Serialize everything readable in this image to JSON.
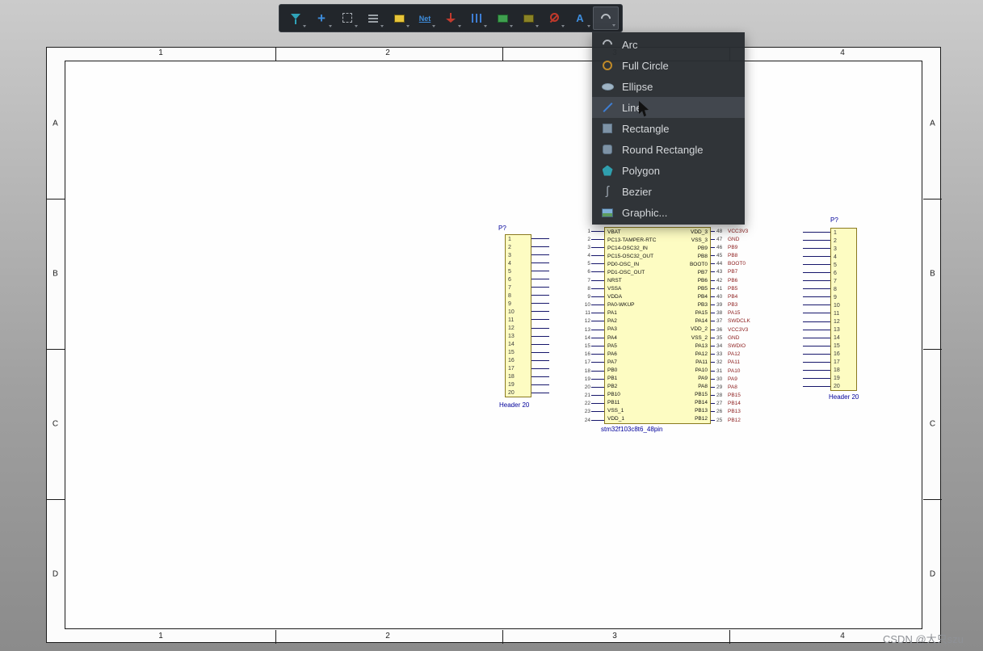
{
  "toolbar": {
    "tools": [
      {
        "id": "filter",
        "glyph": "",
        "active": ""
      },
      {
        "id": "crosshair",
        "glyph": "+",
        "active": ""
      },
      {
        "id": "selection",
        "glyph": "",
        "active": ""
      },
      {
        "id": "align",
        "glyph": "",
        "active": ""
      },
      {
        "id": "place-part",
        "glyph": "",
        "active": ""
      },
      {
        "id": "net-label",
        "glyph": "Net",
        "active": ""
      },
      {
        "id": "power-port",
        "glyph": "",
        "active": ""
      },
      {
        "id": "bus",
        "glyph": "",
        "active": ""
      },
      {
        "id": "sheet-symbol",
        "glyph": "",
        "active": ""
      },
      {
        "id": "sheet-entry",
        "glyph": "",
        "active": ""
      },
      {
        "id": "no-erc",
        "glyph": "",
        "active": ""
      },
      {
        "id": "text-string",
        "glyph": "A",
        "active": ""
      },
      {
        "id": "drawing-tools",
        "glyph": "",
        "active": "active"
      }
    ]
  },
  "menu": {
    "items": [
      {
        "label": "Arc",
        "icon": "arc",
        "state": ""
      },
      {
        "label": "Full Circle",
        "icon": "circle",
        "state": ""
      },
      {
        "label": "Ellipse",
        "icon": "ellipse",
        "state": ""
      },
      {
        "label": "Line",
        "icon": "line",
        "state": "highlighted"
      },
      {
        "label": "Rectangle",
        "icon": "rect",
        "state": ""
      },
      {
        "label": "Round Rectangle",
        "icon": "rrect",
        "state": ""
      },
      {
        "label": "Polygon",
        "icon": "polygon",
        "state": ""
      },
      {
        "label": "Bezier",
        "icon": "bezier",
        "state": ""
      },
      {
        "label": "Graphic...",
        "icon": "graphic",
        "state": ""
      }
    ]
  },
  "sheet": {
    "zone_columns": [
      "1",
      "2",
      "3",
      "4"
    ],
    "zone_rows": [
      "A",
      "B",
      "C",
      "D"
    ]
  },
  "components": {
    "header_left": {
      "designator": "P?",
      "part_name": "Header 20",
      "pins": [
        "1",
        "2",
        "3",
        "4",
        "5",
        "6",
        "7",
        "8",
        "9",
        "10",
        "11",
        "12",
        "13",
        "14",
        "15",
        "16",
        "17",
        "18",
        "19",
        "20"
      ]
    },
    "header_right": {
      "designator": "P?",
      "part_name": "Header 20",
      "pins": [
        "1",
        "2",
        "3",
        "4",
        "5",
        "6",
        "7",
        "8",
        "9",
        "10",
        "11",
        "12",
        "13",
        "14",
        "15",
        "16",
        "17",
        "18",
        "19",
        "20"
      ]
    },
    "mcu": {
      "part_name": "stm32f103c8t6_48pin",
      "left_pins": [
        {
          "num": "1",
          "name": "VBAT"
        },
        {
          "num": "2",
          "name": "PC13-TAMPER-RTC"
        },
        {
          "num": "3",
          "name": "PC14-OSC32_IN"
        },
        {
          "num": "4",
          "name": "PC15-OSC32_OUT"
        },
        {
          "num": "5",
          "name": "PD0-OSC_IN"
        },
        {
          "num": "6",
          "name": "PD1-OSC_OUT"
        },
        {
          "num": "7",
          "name": "NRST"
        },
        {
          "num": "8",
          "name": "VSSA"
        },
        {
          "num": "9",
          "name": "VDDA"
        },
        {
          "num": "10",
          "name": "PA0-WKUP"
        },
        {
          "num": "11",
          "name": "PA1"
        },
        {
          "num": "12",
          "name": "PA2"
        },
        {
          "num": "13",
          "name": "PA3"
        },
        {
          "num": "14",
          "name": "PA4"
        },
        {
          "num": "15",
          "name": "PA5"
        },
        {
          "num": "16",
          "name": "PA6"
        },
        {
          "num": "17",
          "name": "PA7"
        },
        {
          "num": "18",
          "name": "PB0"
        },
        {
          "num": "19",
          "name": "PB1"
        },
        {
          "num": "20",
          "name": "PB2"
        },
        {
          "num": "21",
          "name": "PB10"
        },
        {
          "num": "22",
          "name": "PB11"
        },
        {
          "num": "23",
          "name": "VSS_1"
        },
        {
          "num": "24",
          "name": "VDD_1"
        }
      ],
      "right_pins": [
        {
          "num": "48",
          "name": "VDD_3",
          "net": "VCC3V3"
        },
        {
          "num": "47",
          "name": "VSS_3",
          "net": "GND"
        },
        {
          "num": "46",
          "name": "PB9",
          "net": "PB9"
        },
        {
          "num": "45",
          "name": "PB8",
          "net": "PB8"
        },
        {
          "num": "44",
          "name": "BOOT0",
          "net": "BOOT0"
        },
        {
          "num": "43",
          "name": "PB7",
          "net": "PB7"
        },
        {
          "num": "42",
          "name": "PB6",
          "net": "PB6"
        },
        {
          "num": "41",
          "name": "PB5",
          "net": "PB5"
        },
        {
          "num": "40",
          "name": "PB4",
          "net": "PB4"
        },
        {
          "num": "39",
          "name": "PB3",
          "net": "PB3"
        },
        {
          "num": "38",
          "name": "PA15",
          "net": "PA15"
        },
        {
          "num": "37",
          "name": "PA14",
          "net": "SWDCLK"
        },
        {
          "num": "36",
          "name": "VDD_2",
          "net": "VCC3V3"
        },
        {
          "num": "35",
          "name": "VSS_2",
          "net": "GND"
        },
        {
          "num": "34",
          "name": "PA13",
          "net": "SWDIO"
        },
        {
          "num": "33",
          "name": "PA12",
          "net": "PA12"
        },
        {
          "num": "32",
          "name": "PA11",
          "net": "PA11"
        },
        {
          "num": "31",
          "name": "PA10",
          "net": "PA10"
        },
        {
          "num": "30",
          "name": "PA9",
          "net": "PA9"
        },
        {
          "num": "29",
          "name": "PA8",
          "net": "PA8"
        },
        {
          "num": "28",
          "name": "PB15",
          "net": "PB15"
        },
        {
          "num": "27",
          "name": "PB14",
          "net": "PB14"
        },
        {
          "num": "26",
          "name": "PB13",
          "net": "PB13"
        },
        {
          "num": "25",
          "name": "PB12",
          "net": "PB12"
        }
      ]
    }
  },
  "watermark": "CSDN @大只szu",
  "colors": {
    "component_fill": "#fdfcc2",
    "component_border": "#8a7a20",
    "net_label": "#8b1a1a",
    "wire": "#16166b",
    "designator": "#00009b"
  }
}
